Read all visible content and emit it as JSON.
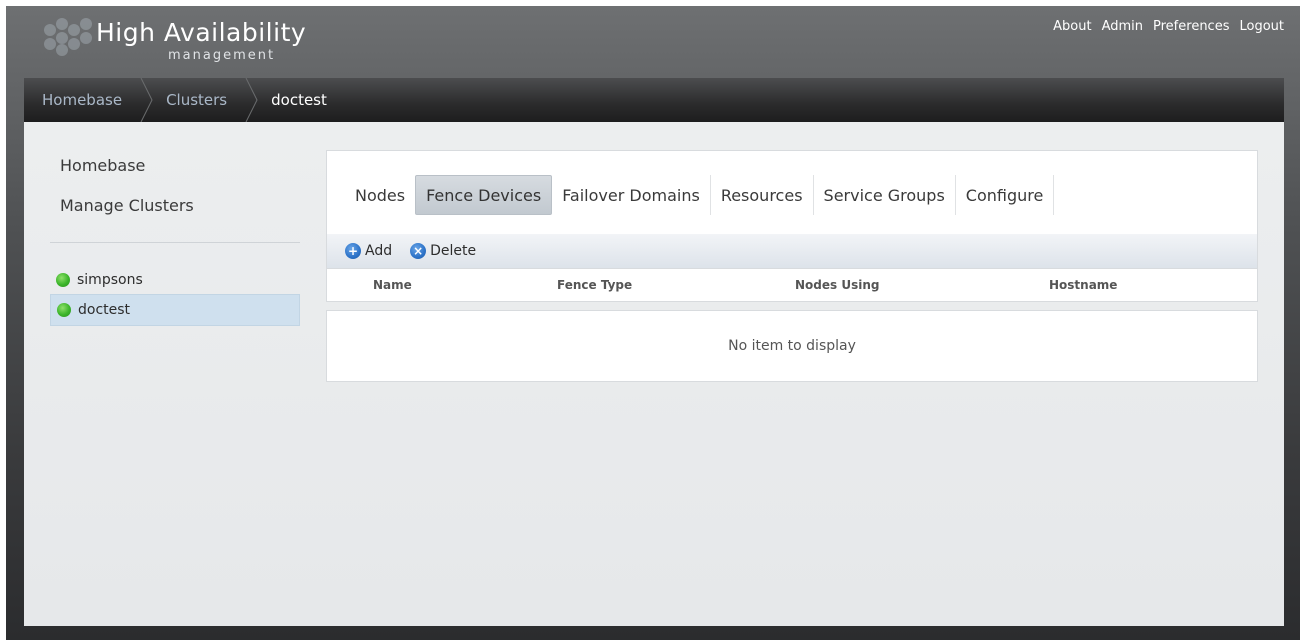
{
  "app": {
    "title": "High Availability",
    "subtitle": "management"
  },
  "topnav": {
    "items": [
      "About",
      "Admin",
      "Preferences",
      "Logout"
    ]
  },
  "breadcrumb": {
    "items": [
      "Homebase",
      "Clusters",
      "doctest"
    ]
  },
  "sidebar": {
    "links": [
      "Homebase",
      "Manage Clusters"
    ],
    "clusters": [
      {
        "name": "simpsons",
        "status": "online",
        "selected": false
      },
      {
        "name": "doctest",
        "status": "online",
        "selected": true
      }
    ]
  },
  "tabs": {
    "items": [
      "Nodes",
      "Fence Devices",
      "Failover Domains",
      "Resources",
      "Service Groups",
      "Configure"
    ],
    "active": "Fence Devices"
  },
  "toolbar": {
    "add_label": "Add",
    "delete_label": "Delete",
    "add_icon": "plus-circle-icon",
    "delete_icon": "x-circle-icon"
  },
  "grid": {
    "columns": [
      "Name",
      "Fence Type",
      "Nodes Using",
      "Hostname"
    ],
    "empty_message": "No item to display"
  },
  "colors": {
    "status_online": "#3bb52a",
    "selected_row": "#cfe0ee",
    "breadcrumb_link": "#aab8c8"
  }
}
